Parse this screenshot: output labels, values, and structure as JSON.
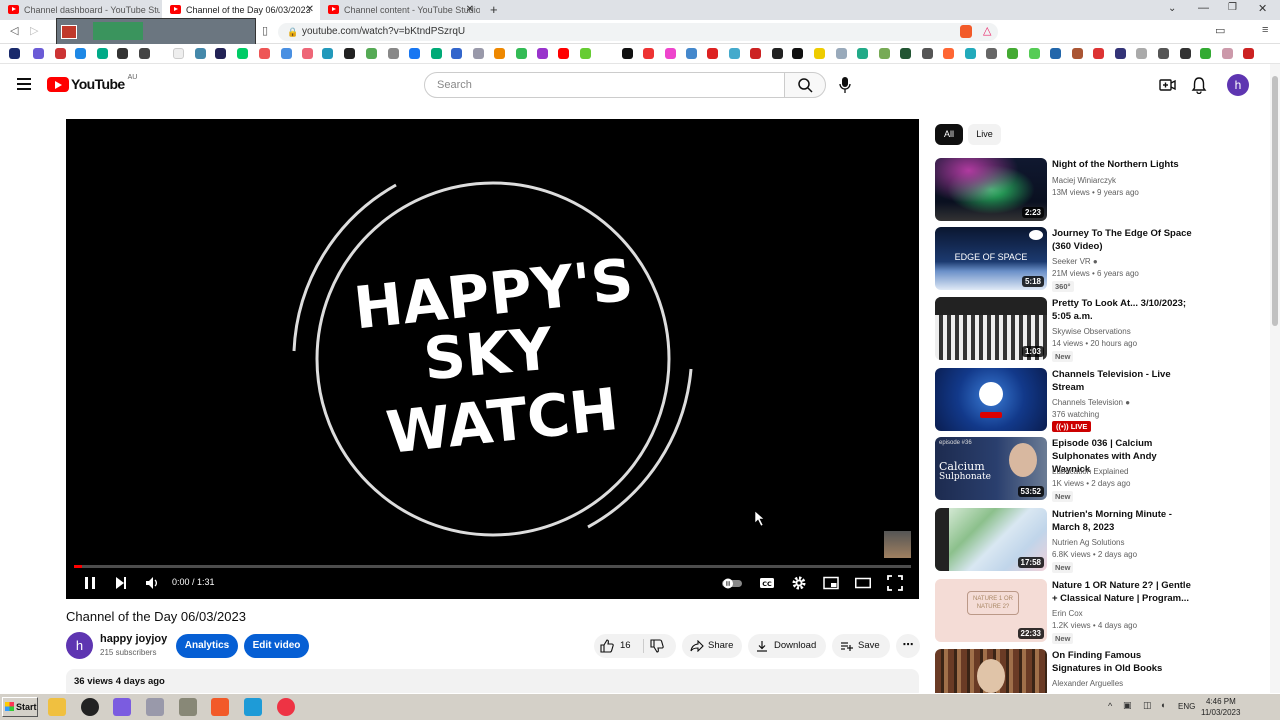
{
  "browser": {
    "tabs": [
      {
        "label": "Channel dashboard - YouTube Studio",
        "active": false
      },
      {
        "label": "Channel of the Day 06/03/2023",
        "active": true
      },
      {
        "label": "Channel content - YouTube Studio",
        "active": false
      }
    ],
    "url": "youtube.com/watch?v=bKtndPSzrqU"
  },
  "header": {
    "logo_text": "YouTube",
    "logo_country": "AU",
    "search_placeholder": "Search",
    "avatar_letter": "h"
  },
  "player": {
    "overlay_lines": [
      "HAPPY'S",
      "SKY",
      "WATCH"
    ],
    "time": "0:00 / 1:31",
    "progress": 0.01
  },
  "video": {
    "title": "Channel of the Day 06/03/2023",
    "channel_initial": "h",
    "channel_name": "happy joyjoy",
    "subscribers": "215 subscribers",
    "analytics_label": "Analytics",
    "edit_label": "Edit video",
    "likes": "16",
    "share_label": "Share",
    "download_label": "Download",
    "save_label": "Save",
    "meta": "36 views  4 days ago"
  },
  "chips": [
    "All",
    "Live"
  ],
  "recommendations": [
    {
      "title": "Night of the Northern Lights",
      "channel": "Maciej Winiarczyk",
      "meta": "13M views • 9 years ago",
      "duration": "2:23",
      "badge": ""
    },
    {
      "title": "Journey To The Edge Of Space (360 Video)",
      "channel": "Seeker VR",
      "meta": "21M views • 6 years ago",
      "duration": "5:18",
      "badge": "360°",
      "thumb_text": "EDGE OF SPACE"
    },
    {
      "title": "Pretty To Look At... 3/10/2023; 5:05 a.m.",
      "channel": "Skywise Observations",
      "meta": "14 views • 20 hours ago",
      "duration": "1:03",
      "badge": "New"
    },
    {
      "title": "Channels Television - Live Stream",
      "channel": "Channels Television",
      "meta": "376 watching",
      "duration": "",
      "badge": "LIVE"
    },
    {
      "title": "Episode 036 | Calcium Sulphonates with Andy Waynick",
      "channel": "Lubrication Explained",
      "meta": "1K views • 2 days ago",
      "duration": "53:52",
      "badge": "New",
      "thumb_text": "Calcium",
      "thumb_text2": "Sulphonate",
      "thumb_small": "episode #36"
    },
    {
      "title": "Nutrien's Morning Minute - March 8, 2023",
      "channel": "Nutrien Ag Solutions",
      "meta": "6.8K views • 2 days ago",
      "duration": "17:58",
      "badge": "New"
    },
    {
      "title": "Nature 1 OR Nature 2? | Gentle + Classical Nature | Program...",
      "channel": "Erin Cox",
      "meta": "1.2K views • 4 days ago",
      "duration": "22:33",
      "badge": "New",
      "thumb_text": "NATURE 1 OR NATURE 2?"
    },
    {
      "title": "On Finding Famous Signatures in Old Books",
      "channel": "Alexander Arguelles",
      "meta": "",
      "duration": "",
      "badge": ""
    }
  ],
  "taskbar": {
    "start_label": "Start",
    "lang": "ENG",
    "time": "4:46 PM",
    "date": "11/03/2023"
  }
}
